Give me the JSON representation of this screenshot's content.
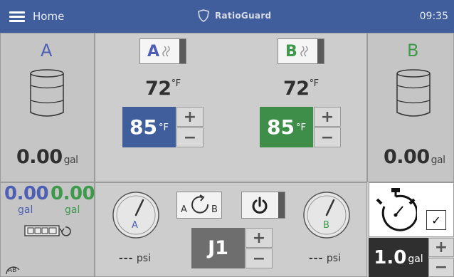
{
  "header": {
    "menu_icon": "hamburger-menu-icon",
    "home_label": "Home",
    "brand_icon": "shield-icon",
    "brand_name": "RatioGuard",
    "time": "09:35",
    "colors": {
      "header_bg": "#3f5e9b"
    }
  },
  "tank_a": {
    "letter": "A",
    "volume": "0.00",
    "unit": "gal",
    "color": "#4d5fb4",
    "icon": "drum-tank-icon"
  },
  "tank_b": {
    "letter": "B",
    "volume": "0.00",
    "unit": "gal",
    "color": "#3c9a4a",
    "icon": "drum-tank-icon"
  },
  "heater_a": {
    "button_letter": "A",
    "button_icon": "heat-wave-icon",
    "actual_temp": "72",
    "actual_unit": "°F",
    "setpoint": "85",
    "setpoint_unit": "°F",
    "setpoint_color": "#3f5e9b",
    "plus": "+",
    "minus": "−"
  },
  "heater_b": {
    "button_letter": "B",
    "button_icon": "heat-wave-icon",
    "actual_temp": "72",
    "actual_unit": "°F",
    "setpoint": "85",
    "setpoint_unit": "°F",
    "setpoint_color": "#3e8e49",
    "plus": "+",
    "minus": "−"
  },
  "totals": {
    "a_value": "0.00",
    "a_unit": "gal",
    "b_value": "0.00",
    "b_unit": "gal",
    "counter_icon": "counter-reset-icon",
    "ratio_icon": "ratio-ab-icon",
    "ratio_label": "AB"
  },
  "pressure": {
    "a_label": "A",
    "b_label": "B",
    "a_value": "---",
    "b_value": "---",
    "unit": "psi",
    "recirc_icon": "recirculate-icon",
    "recirc_a": "A",
    "recirc_b": "B",
    "power_icon": "power-icon",
    "job_label": "J1",
    "plus": "+",
    "minus": "−"
  },
  "timer": {
    "icon": "stopwatch-icon",
    "check": "✓",
    "volume": "1.0",
    "unit": "gal",
    "plus": "+",
    "minus": "−"
  }
}
